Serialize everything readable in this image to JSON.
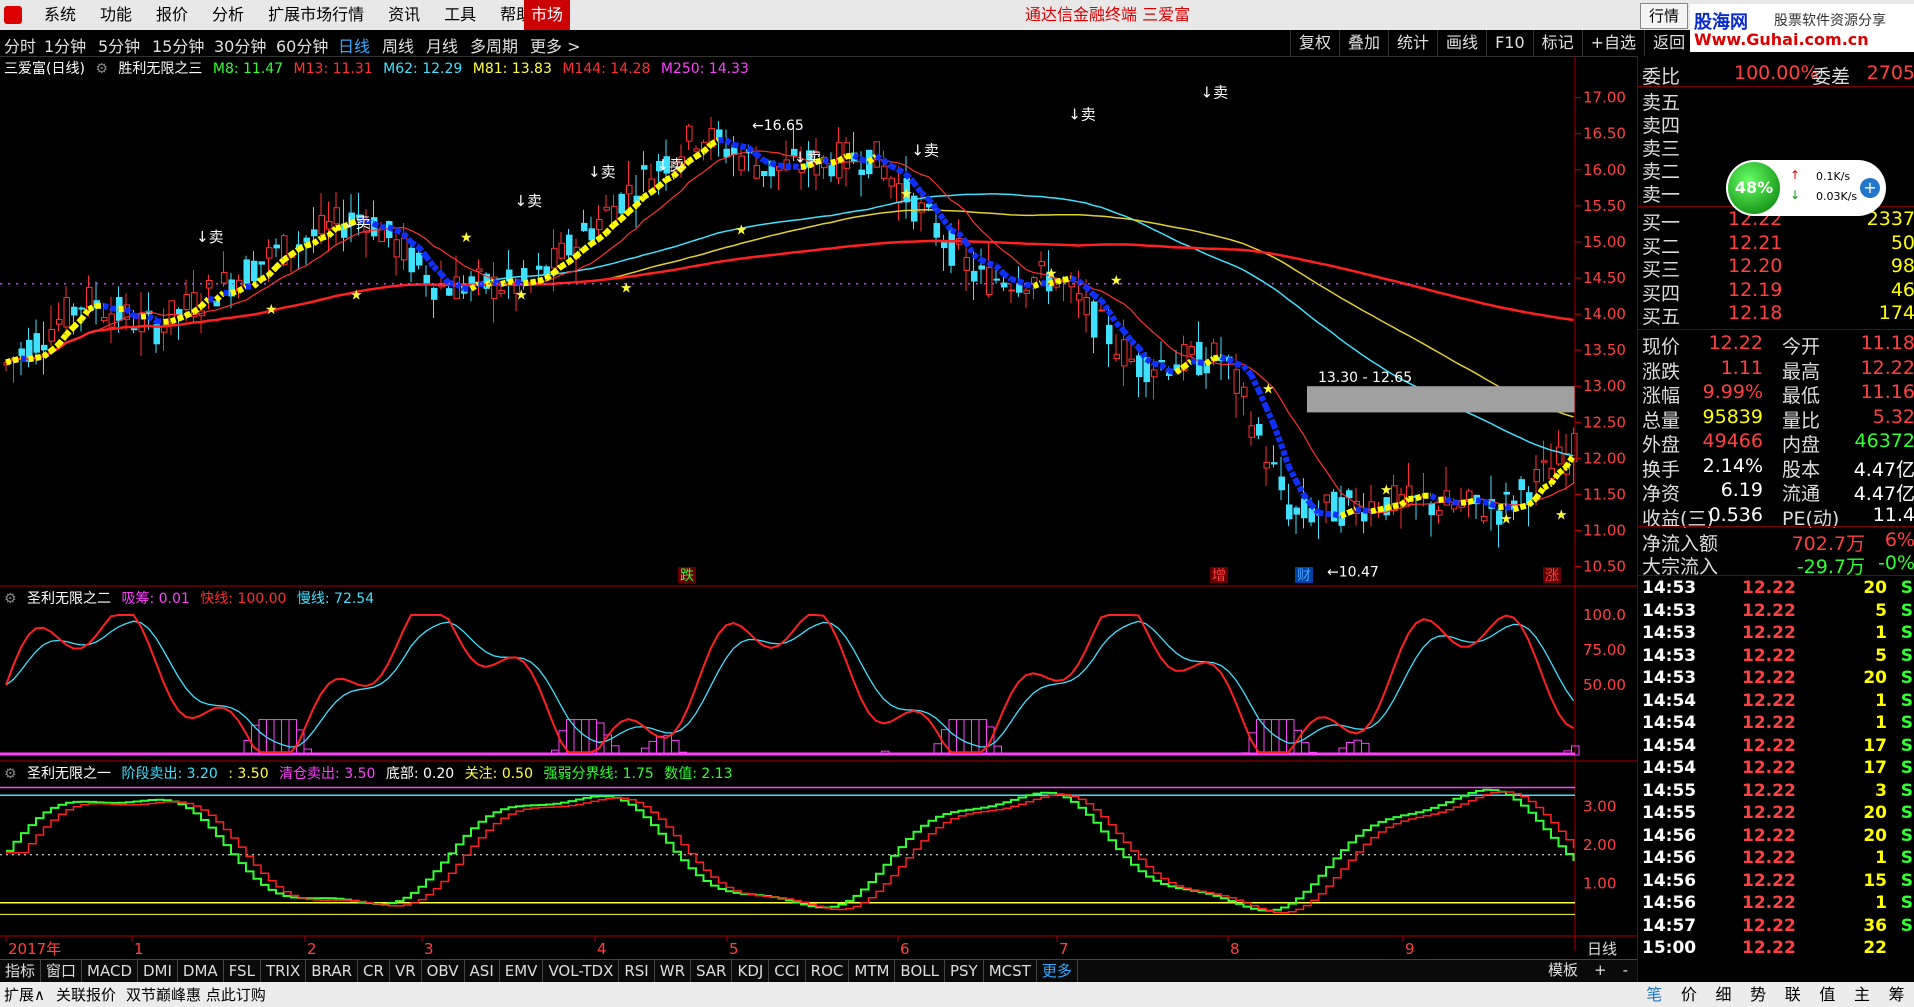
{
  "menubar": {
    "items": [
      "系统",
      "功能",
      "报价",
      "分析",
      "扩展市场行情",
      "资讯",
      "工具",
      "帮助"
    ],
    "market": "市场",
    "title": "通达信金融终端  三爱富",
    "hangqing": "行情",
    "controls": [
      "-",
      "□",
      "×"
    ]
  },
  "brand": {
    "name": "股海网",
    "slogan": "股票软件资源分享",
    "url": "Www.Guhai.com.cn"
  },
  "periods": [
    "分时",
    "1分钟",
    "5分钟",
    "15分钟",
    "30分钟",
    "60分钟",
    "日线",
    "周线",
    "月线",
    "多周期",
    "更多 >"
  ],
  "active_period": "日线",
  "toolbar": [
    "复权",
    "叠加",
    "统计",
    "画线",
    "F10",
    "标记",
    "+自选",
    "返回"
  ],
  "main_panel": {
    "stock": "三爱富(日线)",
    "indicator": "胜利无限之三",
    "mas": [
      {
        "label": "M8: 11.47",
        "color": "#30ff30"
      },
      {
        "label": "M13: 11.31",
        "color": "#ff3030"
      },
      {
        "label": "M62: 12.29",
        "color": "#40e0ff"
      },
      {
        "label": "M81: 13.83",
        "color": "#ffff40"
      },
      {
        "label": "M144: 14.28",
        "color": "#ff3030"
      },
      {
        "label": "M250: 14.33",
        "color": "#ff40ff"
      }
    ],
    "sell_tag": "卖",
    "high_label": "16.65",
    "low_label": "10.47",
    "range_label": "13.30 - 12.65",
    "event_tags": [
      "跌",
      "增",
      "财",
      "涨"
    ],
    "y_ticks": [
      "17.00",
      "16.50",
      "16.00",
      "15.50",
      "15.00",
      "14.50",
      "14.00",
      "13.50",
      "13.00",
      "12.50",
      "12.00",
      "11.50",
      "11.00",
      "10.50"
    ]
  },
  "panel2": {
    "name": "圣利无限之二",
    "params": [
      {
        "label": "吸筹: 0.01",
        "color": "#ff40ff"
      },
      {
        "label": "快线: 100.00",
        "color": "#ff3030"
      },
      {
        "label": "慢线: 72.54",
        "color": "#40e0ff"
      }
    ],
    "y_ticks": [
      "100.0",
      "75.00",
      "50.00"
    ]
  },
  "panel3": {
    "name": "圣利无限之一",
    "params": [
      {
        "label": "阶段卖出: 3.20",
        "color": "#40e0ff"
      },
      {
        "label": ": 3.50",
        "color": "#ffff40"
      },
      {
        "label": "清仓卖出: 3.50",
        "color": "#ff40ff"
      },
      {
        "label": "底部: 0.20",
        "color": "#ffffff"
      },
      {
        "label": "关注: 0.50",
        "color": "#ffff40"
      },
      {
        "label": "强弱分界线: 1.75",
        "color": "#30ff30"
      },
      {
        "label": "数值: 2.13",
        "color": "#30ff30"
      }
    ],
    "y_ticks": [
      "3.00",
      "2.00",
      "1.00"
    ]
  },
  "x_axis": {
    "labels": [
      "2017年",
      "1",
      "2",
      "3",
      "4",
      "5",
      "6",
      "7",
      "8",
      "9"
    ],
    "period": "日线"
  },
  "chart_data": {
    "type": "line",
    "title": "三爱富(日线)",
    "series": [
      {
        "name": "M144",
        "values": [
          14.0,
          14.05,
          14.1,
          14.15,
          14.25,
          14.35,
          14.5,
          14.62,
          14.68,
          14.6,
          14.45
        ]
      },
      {
        "name": "M62",
        "values": [
          13.9,
          14.0,
          14.2,
          14.4,
          14.8,
          15.0,
          15.4,
          15.3,
          14.5,
          13.4,
          12.3
        ]
      }
    ],
    "ylim": [
      10.3,
      17.3
    ]
  },
  "order_book": {
    "weibi_label": "委比",
    "weibi_value": "100.00%",
    "weicha_label": "委差",
    "weicha_value": "2705",
    "sells": [
      "卖五",
      "卖四",
      "卖三",
      "卖二",
      "卖一"
    ],
    "buys": [
      {
        "label": "买一",
        "price": "12.22",
        "vol": "2337"
      },
      {
        "label": "买二",
        "price": "12.21",
        "vol": "50"
      },
      {
        "label": "买三",
        "price": "12.20",
        "vol": "98"
      },
      {
        "label": "买四",
        "price": "12.19",
        "vol": "46"
      },
      {
        "label": "买五",
        "price": "12.18",
        "vol": "174"
      }
    ]
  },
  "widget": {
    "percent": "48%",
    "up": "0.1K/s",
    "down": "0.03K/s"
  },
  "quote": [
    {
      "l1": "现价",
      "v1": "12.22",
      "l2": "今开",
      "v2": "11.18",
      "c1": "red",
      "c2": "red"
    },
    {
      "l1": "涨跌",
      "v1": "1.11",
      "l2": "最高",
      "v2": "12.22",
      "c1": "red",
      "c2": "red"
    },
    {
      "l1": "涨幅",
      "v1": "9.99%",
      "l2": "最低",
      "v2": "11.16",
      "c1": "red",
      "c2": "red"
    },
    {
      "l1": "总量",
      "v1": "95839",
      "l2": "量比",
      "v2": "5.32",
      "c1": "yellow",
      "c2": "red"
    },
    {
      "l1": "外盘",
      "v1": "49466",
      "l2": "内盘",
      "v2": "46372",
      "c1": "red",
      "c2": "green"
    },
    {
      "l1": "换手",
      "v1": "2.14%",
      "l2": "股本",
      "v2": "4.47亿",
      "c1": "white",
      "c2": "white"
    },
    {
      "l1": "净资",
      "v1": "6.19",
      "l2": "流通",
      "v2": "4.47亿",
      "c1": "white",
      "c2": "white"
    },
    {
      "l1": "收益(三)",
      "v1": "0.536",
      "l2": "PE(动)",
      "v2": "11.4",
      "c1": "white",
      "c2": "white"
    }
  ],
  "flows": [
    {
      "label": "净流入额",
      "value": "702.7万",
      "pct": "6%",
      "color": "red"
    },
    {
      "label": "大宗流入",
      "value": "-29.7万",
      "pct": "-0%",
      "color": "green"
    }
  ],
  "ticks": [
    {
      "t": "14:53",
      "p": "12.22",
      "v": "20",
      "s": "S"
    },
    {
      "t": "14:53",
      "p": "12.22",
      "v": "5",
      "s": "S"
    },
    {
      "t": "14:53",
      "p": "12.22",
      "v": "1",
      "s": "S"
    },
    {
      "t": "14:53",
      "p": "12.22",
      "v": "5",
      "s": "S"
    },
    {
      "t": "14:53",
      "p": "12.22",
      "v": "20",
      "s": "S"
    },
    {
      "t": "14:54",
      "p": "12.22",
      "v": "1",
      "s": "S"
    },
    {
      "t": "14:54",
      "p": "12.22",
      "v": "1",
      "s": "S"
    },
    {
      "t": "14:54",
      "p": "12.22",
      "v": "17",
      "s": "S"
    },
    {
      "t": "14:54",
      "p": "12.22",
      "v": "17",
      "s": "S"
    },
    {
      "t": "14:55",
      "p": "12.22",
      "v": "3",
      "s": "S"
    },
    {
      "t": "14:55",
      "p": "12.22",
      "v": "20",
      "s": "S"
    },
    {
      "t": "14:56",
      "p": "12.22",
      "v": "20",
      "s": "S"
    },
    {
      "t": "14:56",
      "p": "12.22",
      "v": "1",
      "s": "S"
    },
    {
      "t": "14:56",
      "p": "12.22",
      "v": "15",
      "s": "S"
    },
    {
      "t": "14:56",
      "p": "12.22",
      "v": "1",
      "s": "S"
    },
    {
      "t": "14:57",
      "p": "12.22",
      "v": "36",
      "s": "S"
    },
    {
      "t": "15:00",
      "p": "12.22",
      "v": "22",
      "s": ""
    }
  ],
  "indicator_tabs": [
    "指标",
    "窗口",
    "MACD",
    "DMI",
    "DMA",
    "FSL",
    "TRIX",
    "BRAR",
    "CR",
    "VR",
    "OBV",
    "ASI",
    "EMV",
    "VOL-TDX",
    "RSI",
    "WR",
    "SAR",
    "KDJ",
    "CCI",
    "ROC",
    "MTM",
    "BOLL",
    "PSY",
    "MCST",
    "更多"
  ],
  "right_bottom_tabs": [
    "模板",
    "+",
    "-"
  ],
  "status": [
    "扩展∧",
    "关联报价",
    "双节巅峰惠 点此订购"
  ],
  "right_tabs": [
    "笔",
    "价",
    "细",
    "势",
    "联",
    "值",
    "主",
    "筹"
  ]
}
